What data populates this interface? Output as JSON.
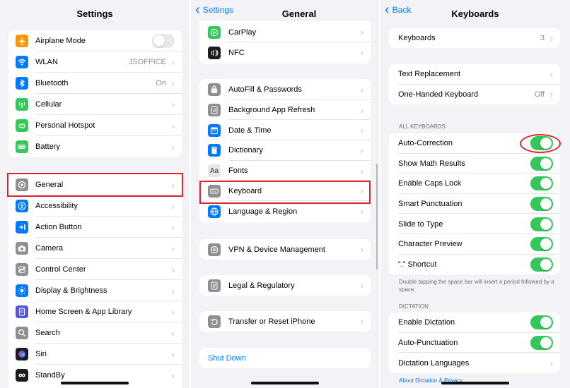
{
  "settings": {
    "title": "Settings",
    "group1": [
      {
        "label": "Airplane Mode",
        "icon": "airplane-icon",
        "color": "#ff9500",
        "toggle": false
      },
      {
        "label": "WLAN",
        "icon": "wifi-icon",
        "color": "#007aff",
        "value": "JSOFFICE"
      },
      {
        "label": "Bluetooth",
        "icon": "bluetooth-icon",
        "color": "#007aff",
        "value": "On"
      },
      {
        "label": "Cellular",
        "icon": "antenna-icon",
        "color": "#34c759"
      },
      {
        "label": "Personal Hotspot",
        "icon": "hotspot-icon",
        "color": "#34c759"
      },
      {
        "label": "Battery",
        "icon": "battery-icon",
        "color": "#34c759"
      }
    ],
    "group2": [
      {
        "label": "General",
        "icon": "gear-icon",
        "color": "#8e8e93"
      },
      {
        "label": "Accessibility",
        "icon": "accessibility-icon",
        "color": "#007aff"
      },
      {
        "label": "Action Button",
        "icon": "action-button-icon",
        "color": "#007aff"
      },
      {
        "label": "Camera",
        "icon": "camera-icon",
        "color": "#8e8e93"
      },
      {
        "label": "Control Center",
        "icon": "control-center-icon",
        "color": "#8e8e93"
      },
      {
        "label": "Display & Brightness",
        "icon": "sun-icon",
        "color": "#007aff"
      },
      {
        "label": "Home Screen & App Library",
        "icon": "home-screen-icon",
        "color": "#5856d6"
      },
      {
        "label": "Search",
        "icon": "search-icon",
        "color": "#8e8e93"
      },
      {
        "label": "Siri",
        "icon": "siri-icon",
        "color": "#1c1c1e"
      },
      {
        "label": "StandBy",
        "icon": "standby-icon",
        "color": "#1c1c1e"
      }
    ]
  },
  "general": {
    "back": "Settings",
    "title": "General",
    "group1": [
      {
        "label": "CarPlay",
        "icon": "carplay-icon",
        "color": "#34c759"
      },
      {
        "label": "NFC",
        "icon": "nfc-icon",
        "color": "#1c1c1e"
      }
    ],
    "group2": [
      {
        "label": "AutoFill & Passwords",
        "icon": "key-icon",
        "color": "#8e8e93"
      },
      {
        "label": "Background App Refresh",
        "icon": "refresh-icon",
        "color": "#8e8e93"
      },
      {
        "label": "Date & Time",
        "icon": "calendar-icon",
        "color": "#007aff"
      },
      {
        "label": "Dictionary",
        "icon": "book-icon",
        "color": "#007aff"
      },
      {
        "label": "Fonts",
        "icon": "fonts-icon",
        "glyph": "Aa",
        "color": "#e5e5ea"
      },
      {
        "label": "Keyboard",
        "icon": "keyboard-icon",
        "color": "#8e8e93"
      },
      {
        "label": "Language & Region",
        "icon": "globe-icon",
        "color": "#007aff"
      }
    ],
    "group3": [
      {
        "label": "VPN & Device Management",
        "icon": "vpn-gear-icon",
        "color": "#8e8e93"
      }
    ],
    "group4": [
      {
        "label": "Legal & Regulatory",
        "icon": "legal-icon",
        "color": "#8e8e93"
      }
    ],
    "group5": [
      {
        "label": "Transfer or Reset iPhone",
        "icon": "reset-icon",
        "color": "#8e8e93"
      }
    ],
    "shutdown": "Shut Down"
  },
  "keyboards": {
    "back": "Back",
    "title": "Keyboards",
    "keyboards_row": {
      "label": "Keyboards",
      "value": "3"
    },
    "group2": [
      {
        "label": "Text Replacement"
      },
      {
        "label": "One-Handed Keyboard",
        "value": "Off"
      }
    ],
    "all_keyboards_caption": "ALL KEYBOARDS",
    "toggles": [
      {
        "label": "Auto-Correction",
        "on": true
      },
      {
        "label": "Show Math Results",
        "on": true
      },
      {
        "label": "Enable Caps Lock",
        "on": true
      },
      {
        "label": "Smart Punctuation",
        "on": true
      },
      {
        "label": "Slide to Type",
        "on": true
      },
      {
        "label": "Character Preview",
        "on": true
      },
      {
        "label": "“.” Shortcut",
        "on": true
      }
    ],
    "shortcut_note": "Double tapping the space bar will insert a period followed by a space.",
    "dictation_caption": "DICTATION",
    "dictation": [
      {
        "label": "Enable Dictation",
        "on": true
      },
      {
        "label": "Auto-Punctuation",
        "on": true
      },
      {
        "label": "Dictation Languages"
      }
    ],
    "about_link": "About Dictation & Privacy"
  },
  "colors": {
    "accent": "#007aff",
    "toggle_on": "#34c759",
    "highlight": "#e0242e"
  }
}
